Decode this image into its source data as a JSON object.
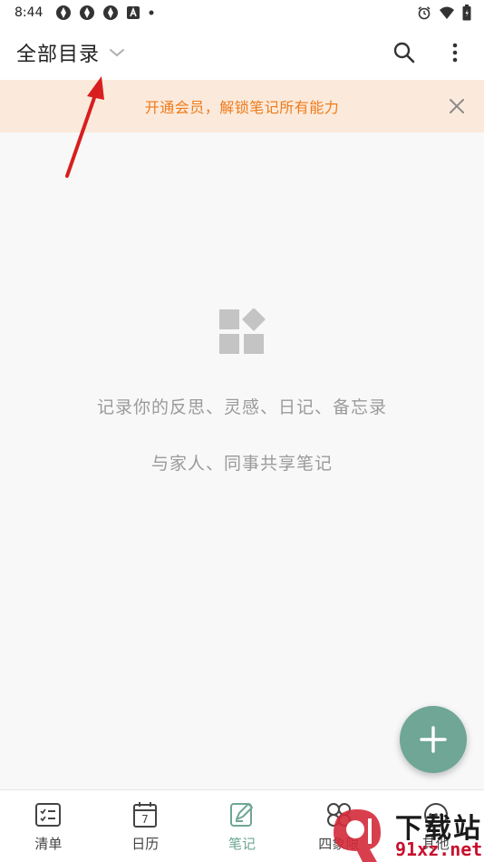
{
  "status_bar": {
    "time": "8:44"
  },
  "app_bar": {
    "directory_title": "全部目录"
  },
  "promo": {
    "text": "开通会员，解锁笔记所有能力"
  },
  "empty_state": {
    "line1": "记录你的反思、灵感、日记、备忘录",
    "line2": "与家人、同事共享笔记"
  },
  "bottom_nav": {
    "items": [
      {
        "label": "清单",
        "icon": "checklist-icon"
      },
      {
        "label": "日历",
        "icon": "calendar-icon",
        "day": "7"
      },
      {
        "label": "笔记",
        "icon": "note-icon",
        "active": true
      },
      {
        "label": "四象限",
        "icon": "quadrant-icon"
      },
      {
        "label": "其他",
        "icon": "more-icon"
      }
    ]
  },
  "watermark": {
    "title": "下载站",
    "domain": "91xz.net"
  },
  "colors": {
    "accent": "#6fa695",
    "promo_text": "#f07a1a",
    "promo_bg": "#fbeadb",
    "annotation_arrow": "#e02020"
  }
}
